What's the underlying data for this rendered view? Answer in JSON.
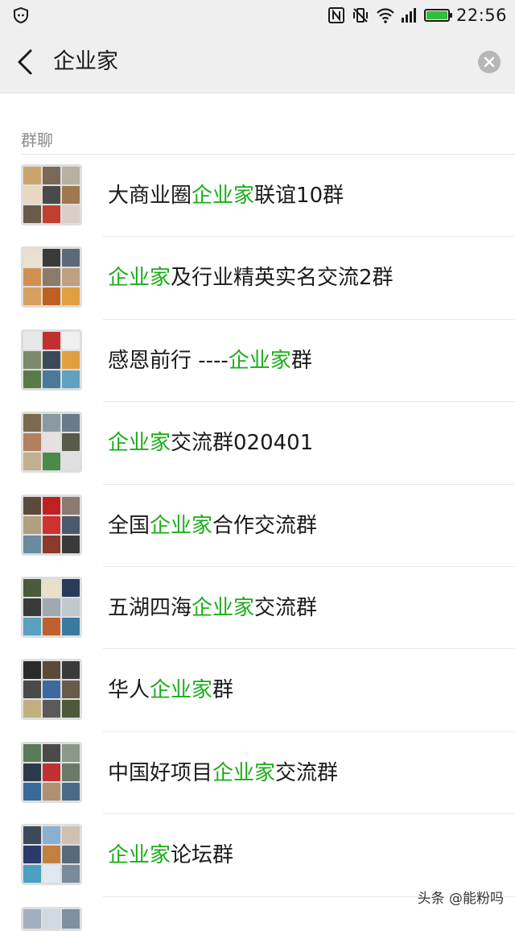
{
  "status_bar": {
    "time": "22:56",
    "battery_level": 1.0,
    "icons": [
      "shield-icon",
      "nfc-icon",
      "vibrate-icon",
      "wifi-icon",
      "signal-icon",
      "battery-icon"
    ]
  },
  "search": {
    "query": "企业家",
    "back_icon": "chevron-left-icon",
    "clear_icon": "clear-icon"
  },
  "section": {
    "title": "群聊"
  },
  "groups": [
    {
      "pre": "大商业圈",
      "hl": "企业家",
      "post": "联谊10群",
      "tiles": [
        "#c9a46a",
        "#7a6a55",
        "#b8b0a0",
        "#e8d8c0",
        "#4a4a4a",
        "#a07850",
        "#6a5a4a",
        "#c04030",
        "#d8d0c8"
      ]
    },
    {
      "pre": "",
      "hl": "企业家",
      "post": "及行业精英实名交流2群",
      "tiles": [
        "#e8e0d0",
        "#3a3a3a",
        "#5a6a7a",
        "#d09050",
        "#8a7a6a",
        "#c0a080",
        "#d8a060",
        "#c06020",
        "#e0a040"
      ]
    },
    {
      "pre": "感恩前行 ----",
      "hl": "企业家",
      "post": "群",
      "tiles": [
        "#e8e8e8",
        "#c03030",
        "#f0f0f0",
        "#7a8a6a",
        "#3a4a5a",
        "#e0a040",
        "#5a7a4a",
        "#4a7a9a",
        "#60a0c0"
      ]
    },
    {
      "pre": "",
      "hl": "企业家",
      "post": "交流群020401",
      "tiles": [
        "#7a6a50",
        "#8a9aa0",
        "#6a7a8a",
        "#b08060",
        "#e8e0e0",
        "#5a5a4a",
        "#c0b090",
        "#4a8a4a",
        "#e0e0e0"
      ]
    },
    {
      "pre": "全国",
      "hl": "企业家",
      "post": "合作交流群",
      "tiles": [
        "#5a4a3a",
        "#c02020",
        "#8a7a70",
        "#b0a080",
        "#d03030",
        "#4a5a6a",
        "#6a8aa0",
        "#8a3a2a",
        "#3a3a3a"
      ]
    },
    {
      "pre": "五湖四海",
      "hl": "企业家",
      "post": "交流群",
      "tiles": [
        "#4a5a3a",
        "#e8e0c8",
        "#2a3a5a",
        "#3a3a3a",
        "#a0a8b0",
        "#c0c8d0",
        "#5aa0c0",
        "#c06030",
        "#3a7aa0"
      ]
    },
    {
      "pre": "华人",
      "hl": "企业家",
      "post": "群",
      "tiles": [
        "#2a2a2a",
        "#5a4a3a",
        "#3a3a3a",
        "#4a4a4a",
        "#3a6aa0",
        "#6a5a4a",
        "#c0b080",
        "#5a5a5a",
        "#4a5a3a"
      ]
    },
    {
      "pre": "中国好项目",
      "hl": "企业家",
      "post": "交流群",
      "tiles": [
        "#5a7a5a",
        "#4a4a4a",
        "#8a9a8a",
        "#2a3a4a",
        "#c03030",
        "#6a7a6a",
        "#3a6a9a",
        "#b09070",
        "#4a6a8a"
      ]
    },
    {
      "pre": "",
      "hl": "企业家",
      "post": "论坛群",
      "tiles": [
        "#3a4a5a",
        "#8ab0d0",
        "#d0c0b0",
        "#2a3a6a",
        "#c08040",
        "#5a6a7a",
        "#4aa0c0",
        "#e0e8f0",
        "#7a8a9a"
      ]
    }
  ],
  "watermark": "头条 @能粉吗"
}
